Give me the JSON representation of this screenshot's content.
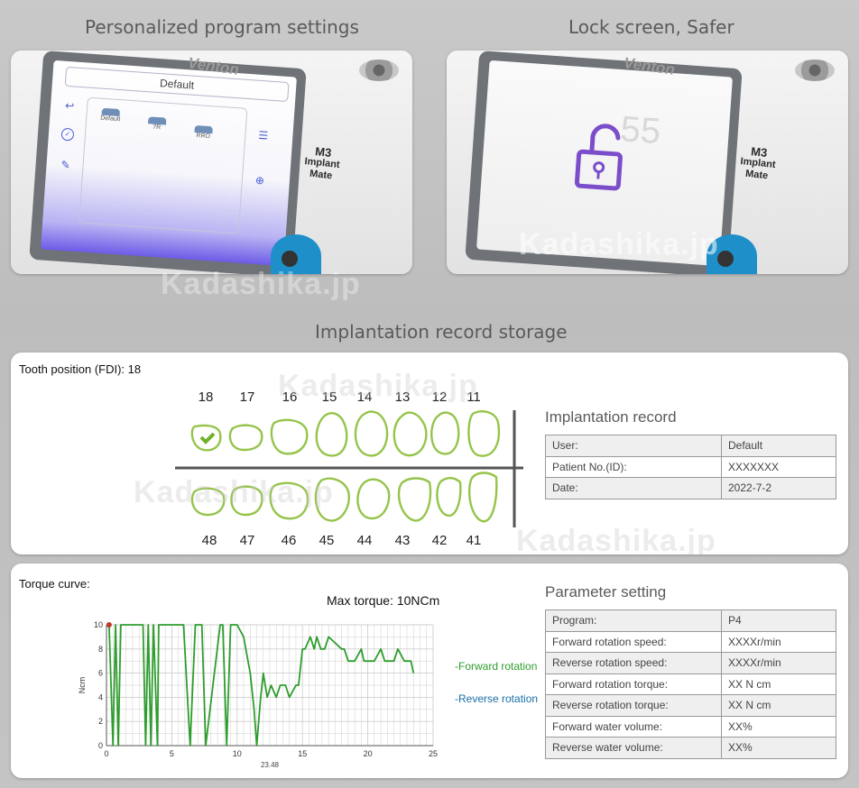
{
  "headings": {
    "program": "Personalized program settings",
    "lock": "Lock screen, Safer",
    "storage": "Implantation record storage"
  },
  "device": {
    "brand": "Venton",
    "model": "M3",
    "model_sub": "Implant Mate"
  },
  "program_screen": {
    "title": "Default",
    "programs": [
      "Default",
      "7R",
      "RRO"
    ]
  },
  "lock_screen": {
    "background_digits": "55"
  },
  "watermark": "Kadashika.jp",
  "tooth_record": {
    "position_label": "Tooth position (FDI): 18",
    "upper": [
      "18",
      "17",
      "16",
      "15",
      "14",
      "13",
      "12",
      "11"
    ],
    "lower": [
      "48",
      "47",
      "46",
      "45",
      "44",
      "43",
      "42",
      "41"
    ],
    "selected": "18",
    "accent_color": "#95c44a",
    "record_title": "Implantation record",
    "rows": [
      {
        "label": "User:",
        "value": "Default"
      },
      {
        "label": "Patient No.(ID):",
        "value": "XXXXXXX"
      },
      {
        "label": "Date:",
        "value": "2022-7-2"
      }
    ]
  },
  "torque": {
    "label": "Torque curve:",
    "max_torque": "Max torque: 10NCm",
    "legend_forward": "-Forward rotation",
    "legend_reverse": "-Reverse rotation",
    "y_axis_label": "Ncm",
    "x_label": "23.48",
    "forward_color": "#2e9d2e",
    "reverse_color": "#1b6fa8"
  },
  "parameters": {
    "title": "Parameter setting",
    "rows": [
      {
        "label": "Program:",
        "value": "P4"
      },
      {
        "label": "Forward rotation speed:",
        "value": "XXXXr/min"
      },
      {
        "label": "Reverse rotation speed:",
        "value": "XXXXr/min"
      },
      {
        "label": "Forward rotation torque:",
        "value": "XX N cm"
      },
      {
        "label": "Reverse rotation torque:",
        "value": "XX N cm"
      },
      {
        "label": "Forward water volume:",
        "value": "XX%"
      },
      {
        "label": "Reverse water volume:",
        "value": "XX%"
      }
    ]
  },
  "chart_data": {
    "type": "line",
    "title": "",
    "xlabel": "",
    "ylabel": "Ncm",
    "xlim": [
      0,
      25
    ],
    "ylim": [
      0,
      10
    ],
    "x_ticks": [
      0,
      5,
      10,
      15,
      20,
      25
    ],
    "y_ticks": [
      0,
      2,
      4,
      6,
      8,
      10
    ],
    "grid": true,
    "series": [
      {
        "name": "Forward rotation",
        "x": [
          0.2,
          0.5,
          0.7,
          0.9,
          1.1,
          1.3,
          1.5,
          2.8,
          3.0,
          3.2,
          3.4,
          3.6,
          3.9,
          4.0,
          5.6,
          5.9,
          6.4,
          6.8,
          7.3,
          7.6,
          8.7,
          8.9,
          9.2,
          9.5,
          10.0,
          10.5,
          11.0,
          11.3,
          11.5,
          11.8,
          12.0,
          12.3,
          12.6,
          13.0,
          13.3,
          13.7,
          14.0,
          14.5,
          14.7,
          15.0,
          15.2,
          15.6,
          15.9,
          16.1,
          16.4,
          16.7,
          17.0,
          18.0,
          18.2,
          18.5,
          19.0,
          19.5,
          19.7,
          20.0,
          20.5,
          21.0,
          21.3,
          21.5,
          22.0,
          22.3,
          22.8,
          23.0,
          23.3,
          23.5
        ],
        "y": [
          10,
          0,
          10,
          0,
          10,
          10,
          10,
          10,
          0,
          10,
          0,
          10,
          0,
          10,
          10,
          10,
          0,
          10,
          10,
          0,
          10,
          10,
          0,
          10,
          10,
          9,
          6,
          3,
          0,
          4,
          6,
          4,
          5,
          4,
          5,
          5,
          4,
          5,
          5,
          8,
          8,
          9,
          8,
          9,
          8,
          8,
          9,
          8,
          8,
          7,
          7,
          8,
          7,
          7,
          7,
          8,
          7,
          7,
          7,
          8,
          7,
          7,
          7,
          6
        ]
      }
    ]
  }
}
